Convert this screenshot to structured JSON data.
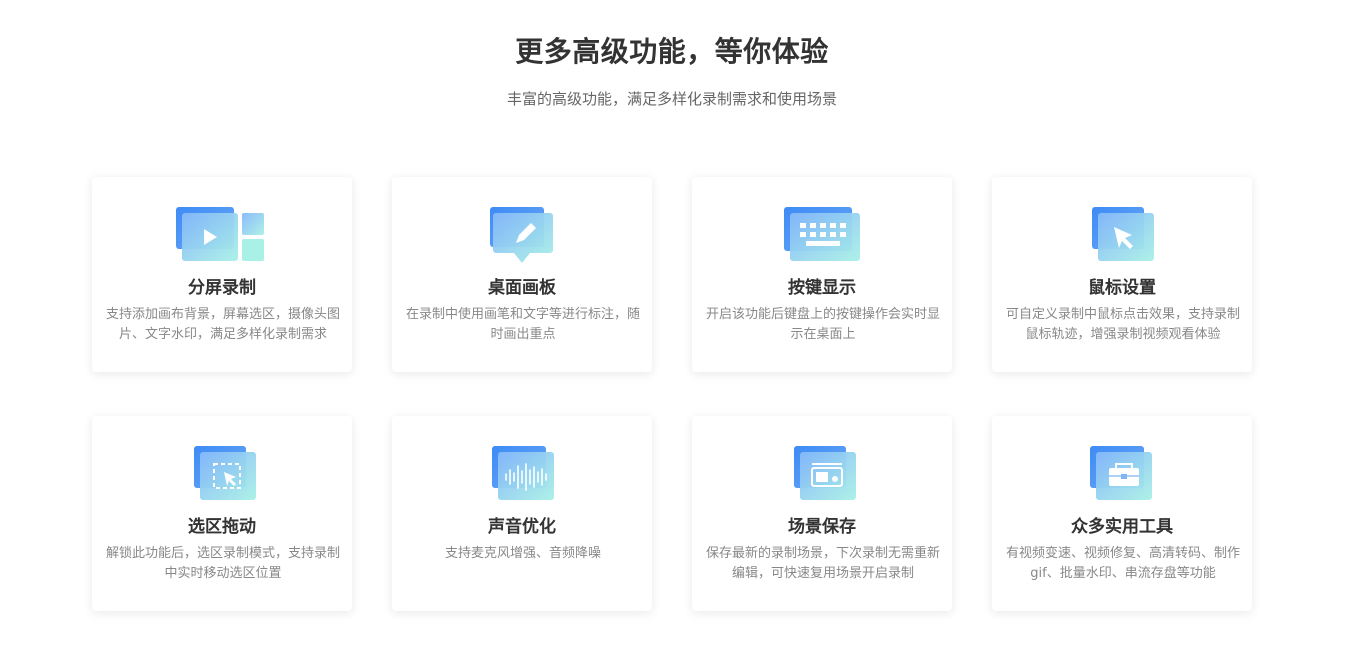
{
  "header": {
    "title": "更多高级功能，等你体验",
    "subtitle": "丰富的高级功能，满足多样化录制需求和使用场景"
  },
  "colors": {
    "accent_blue": "#3d8bf5",
    "accent_cyan": "#7de3e8",
    "title": "#333333",
    "desc": "#888888"
  },
  "features": [
    {
      "icon": "split-screen-icon",
      "title": "分屏录制",
      "desc": "支持添加画布背景，屏幕选区，摄像头图片、文字水印，满足多样化录制需求"
    },
    {
      "icon": "whiteboard-pen-icon",
      "title": "桌面画板",
      "desc": "在录制中使用画笔和文字等进行标注，随时画出重点"
    },
    {
      "icon": "keyboard-icon",
      "title": "按键显示",
      "desc": "开启该功能后键盘上的按键操作会实时显示在桌面上"
    },
    {
      "icon": "mouse-cursor-icon",
      "title": "鼠标设置",
      "desc": "可自定义录制中鼠标点击效果，支持录制鼠标轨迹，增强录制视频观看体验"
    },
    {
      "icon": "region-drag-icon",
      "title": "选区拖动",
      "desc": "解锁此功能后，选区录制模式，支持录制中实时移动选区位置"
    },
    {
      "icon": "audio-wave-icon",
      "title": "声音优化",
      "desc": "支持麦克风增强、音频降噪"
    },
    {
      "icon": "scene-save-icon",
      "title": "场景保存",
      "desc": "保存最新的录制场景，下次录制无需重新编辑，可快速复用场景开启录制"
    },
    {
      "icon": "toolbox-icon",
      "title": "众多实用工具",
      "desc": "有视频变速、视频修复、高清转码、制作gif、批量水印、串流存盘等功能"
    }
  ]
}
